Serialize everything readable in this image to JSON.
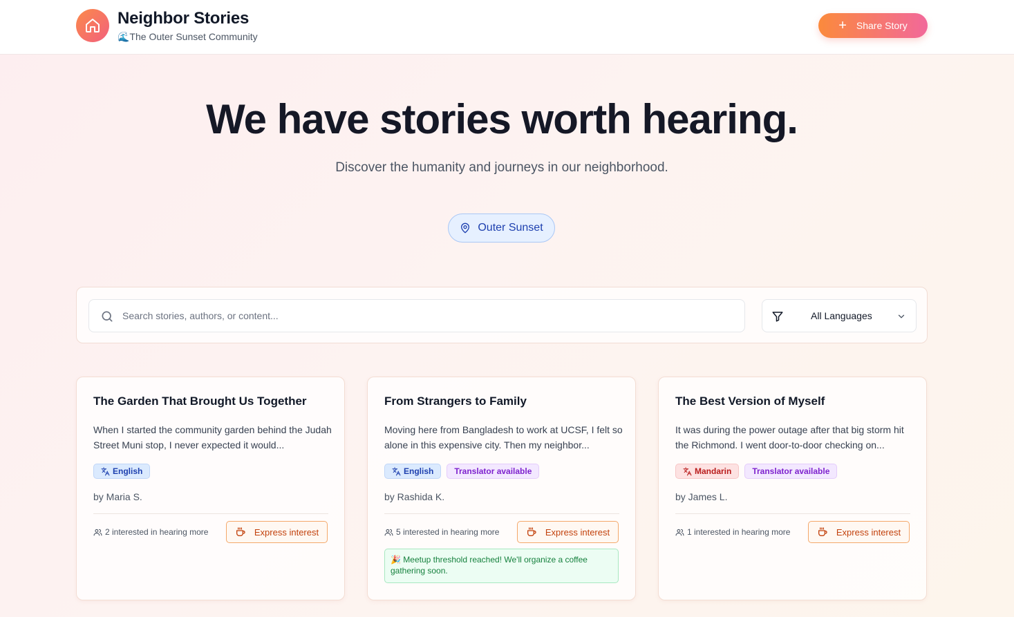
{
  "header": {
    "title": "Neighbor Stories",
    "subtitle": "🌊The Outer Sunset Community",
    "logo_icon": "home-icon",
    "share_label": "Share Story",
    "share_gradient": [
      "#fb8a3c",
      "#f2689a"
    ]
  },
  "hero": {
    "title": "We have stories worth hearing.",
    "subtitle": "Discover the humanity and journeys in our neighborhood.",
    "location": "Outer Sunset",
    "location_icon": "map-pin-icon"
  },
  "search": {
    "placeholder": "Search stories, authors, or content...",
    "value": "",
    "language_filter": "All Languages"
  },
  "interest_button_label": "Express interest",
  "stories": [
    {
      "title": "The Garden That Brought Us Together",
      "excerpt": "When I started the community garden behind the Judah Street Muni stop, I never expected it would...",
      "language": "English",
      "translator": "",
      "author": "by Maria S.",
      "interest": "2 interested in hearing more",
      "meetup": ""
    },
    {
      "title": "From Strangers to Family",
      "excerpt": "Moving here from Bangladesh to work at UCSF, I felt so alone in this expensive city. Then my neighbor...",
      "language": "English",
      "translator": "Translator available",
      "author": "by Rashida K.",
      "interest": "5 interested in hearing more",
      "meetup": "🎉 Meetup threshold reached! We'll organize a coffee gathering soon."
    },
    {
      "title": "The Best Version of Myself",
      "excerpt": "It was during the power outage after that big storm hit the Richmond. I went door-to-door checking on...",
      "language": "Mandarin",
      "translator": "Translator available",
      "author": "by James L.",
      "interest": "1 interested in hearing more",
      "meetup": ""
    }
  ]
}
